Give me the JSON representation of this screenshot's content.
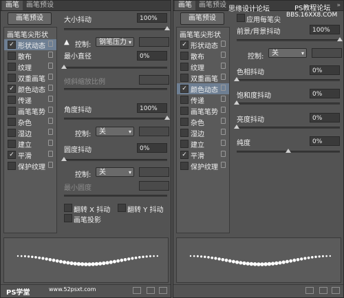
{
  "left": {
    "tabs": [
      "画笔",
      "画笔预设"
    ],
    "preset_button": "画笔预设",
    "sidebar": {
      "header": "画笔笔尖形状",
      "items": [
        {
          "label": "形状动态",
          "checked": true,
          "selected": true
        },
        {
          "label": "散布",
          "checked": false
        },
        {
          "label": "纹理",
          "checked": false
        },
        {
          "label": "双重画笔",
          "checked": false
        },
        {
          "label": "颜色动态",
          "checked": true
        },
        {
          "label": "传递",
          "checked": false
        },
        {
          "label": "画笔笔势",
          "checked": false
        },
        {
          "label": "杂色",
          "checked": false
        },
        {
          "label": "湿边",
          "checked": false
        },
        {
          "label": "建立",
          "checked": false
        },
        {
          "label": "平滑",
          "checked": true
        },
        {
          "label": "保护纹理",
          "checked": false
        }
      ]
    },
    "size_jitter": {
      "label": "大小抖动",
      "value": "100%"
    },
    "control1": {
      "label": "控制:",
      "option": "钢笔压力"
    },
    "min_diameter": {
      "label": "最小直径",
      "value": "0%"
    },
    "tilt_scale": {
      "label": "倾斜缩放比例"
    },
    "angle_jitter": {
      "label": "角度抖动",
      "value": "100%"
    },
    "control2": {
      "label": "控制:",
      "option": "关"
    },
    "roundness_jitter": {
      "label": "圆度抖动",
      "value": "0%"
    },
    "control3": {
      "label": "控制:",
      "option": "关"
    },
    "min_roundness": {
      "label": "最小圆度"
    },
    "flip_x": "翻转 X 抖动",
    "flip_y": "翻转 Y 抖动",
    "brush_projection": "画笔投影",
    "watermark": "PS学堂",
    "watermark2": "www.52psxt.com"
  },
  "right": {
    "tabs": [
      "画笔",
      "画笔预设"
    ],
    "menu_symbol": "»",
    "preset_button": "画笔预设",
    "apply_per_tip": "应用每笔尖",
    "watermark_top1": "思缘设计论坛",
    "watermark_top2": "PS教程论坛",
    "watermark_top3": "BBS.16XX8.COM",
    "sidebar": {
      "header": "画笔笔尖形状",
      "items": [
        {
          "label": "形状动态",
          "checked": true
        },
        {
          "label": "散布",
          "checked": false
        },
        {
          "label": "纹理",
          "checked": false
        },
        {
          "label": "双重画笔",
          "checked": false
        },
        {
          "label": "颜色动态",
          "checked": true,
          "selected": true
        },
        {
          "label": "传递",
          "checked": false
        },
        {
          "label": "画笔笔势",
          "checked": false
        },
        {
          "label": "杂色",
          "checked": false
        },
        {
          "label": "湿边",
          "checked": false
        },
        {
          "label": "建立",
          "checked": false
        },
        {
          "label": "平滑",
          "checked": true
        },
        {
          "label": "保护纹理",
          "checked": false
        }
      ]
    },
    "fg_bg_jitter": {
      "label": "前景/背景抖动",
      "value": "100%"
    },
    "control": {
      "label": "控制:",
      "option": "关"
    },
    "hue_jitter": {
      "label": "色相抖动",
      "value": "0%"
    },
    "saturation_jitter": {
      "label": "饱和度抖动",
      "value": "0%"
    },
    "brightness_jitter": {
      "label": "亮度抖动",
      "value": "0%"
    },
    "purity": {
      "label": "纯度",
      "value": "0%"
    }
  },
  "check_mark": "✓",
  "arrow_down": "▾",
  "warn_symbol": "▲",
  "colors": {
    "panel": "#535353",
    "tabbar": "#3c3c3c",
    "field": "#3a3a3a",
    "selected": "#6e7f93"
  },
  "slider_levels": {
    "size_jitter": 1.0,
    "min_diameter": 0.0,
    "angle_jitter": 1.0,
    "roundness_jitter": 0.0,
    "fg_bg_jitter": 1.0,
    "hue_jitter": 0.0,
    "saturation_jitter": 0.0,
    "brightness_jitter": 0.0,
    "purity": 0.5
  }
}
